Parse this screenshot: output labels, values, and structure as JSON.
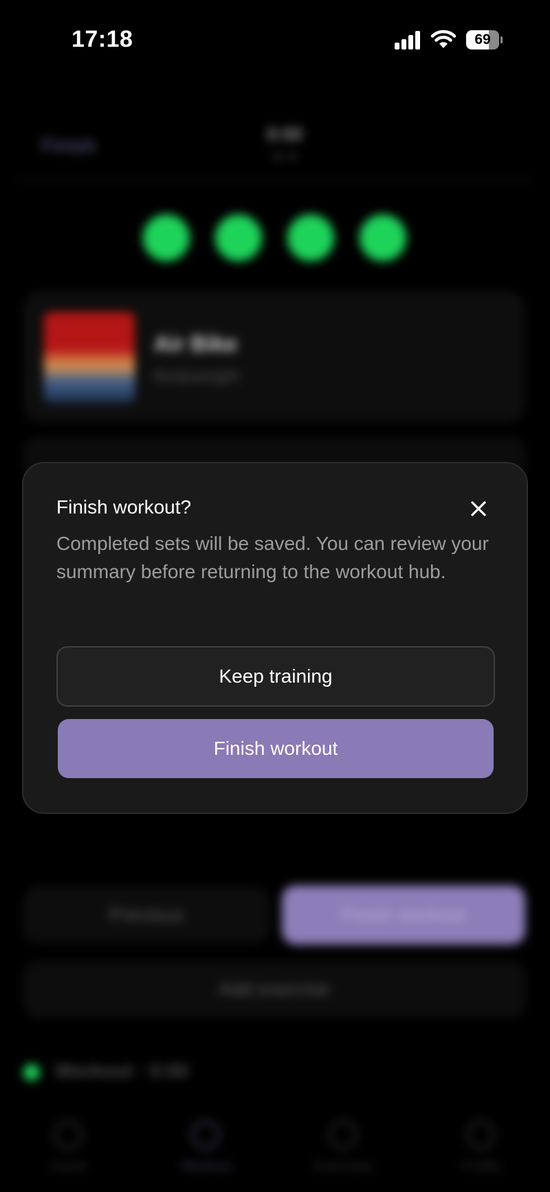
{
  "status_bar": {
    "time": "17:18",
    "battery_level": "69"
  },
  "background": {
    "header": {
      "left_label": "Finish",
      "timer": "0:50",
      "timer_sub": "4 / 4"
    },
    "exercise": {
      "name": "Air Bike",
      "subtitle": "Bodyweight"
    },
    "previous_label": "Previous",
    "finish_label": "Finish workout",
    "add_exercise_label": "Add exercise",
    "live_status": "Workout · 0:50",
    "tabs": [
      {
        "label": "Home"
      },
      {
        "label": "Workout"
      },
      {
        "label": "Exercises"
      },
      {
        "label": "Profile"
      }
    ]
  },
  "modal": {
    "title": "Finish workout?",
    "body": "Completed sets will be saved. You can review your summary before returning to the workout hub.",
    "keep_label": "Keep training",
    "finish_label": "Finish workout"
  },
  "colors": {
    "accent": "#8a7ab5",
    "success": "#1ed35a",
    "modal_bg": "#1a1a1a"
  }
}
